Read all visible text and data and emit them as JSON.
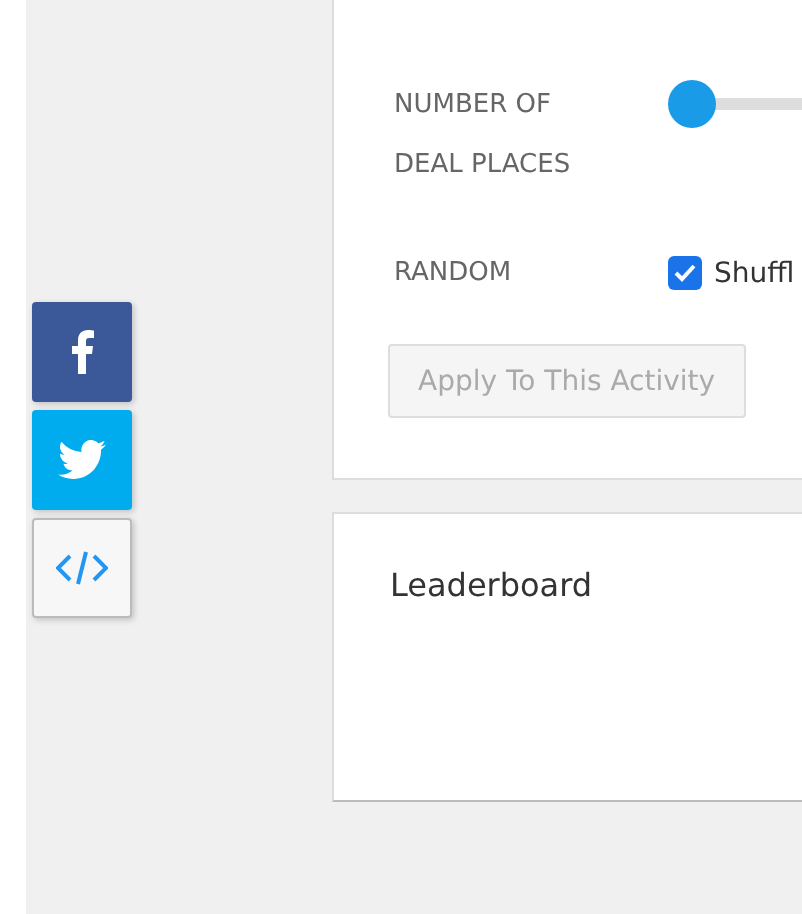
{
  "share_buttons": [
    {
      "kind": "facebook"
    },
    {
      "kind": "twitter"
    },
    {
      "kind": "embed"
    }
  ],
  "settings": {
    "rows": [
      {
        "kind": "slider",
        "label": "NUMBER OF DEAL PLACES",
        "level": 0
      },
      {
        "kind": "checkbox",
        "label": "RANDOM",
        "option": "Shuffl",
        "checked": true
      }
    ],
    "apply_button": {
      "label": "Apply To This Activity",
      "disabled": true
    }
  },
  "leaderboard": {
    "title": "Leaderboard"
  }
}
